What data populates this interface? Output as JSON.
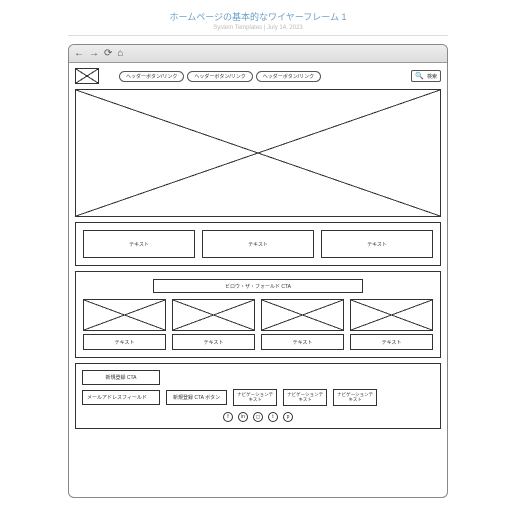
{
  "title": "ホームページの基本的なワイヤーフレーム 1",
  "subtitle": "System Templates  |  July 14, 2023",
  "nav": {
    "link1": "ヘッダーボタン/リンク",
    "link2": "ヘッダーボタン/リンク",
    "link3": "ヘッダーボタン/リンク",
    "search_label": "検索"
  },
  "row3": {
    "t1": "テキスト",
    "t2": "テキスト",
    "t3": "テキスト"
  },
  "cta": "ビロウ・ザ・フォールド CTA",
  "grid": {
    "cap": "テキスト"
  },
  "bottom": {
    "signup_cta": "新規登録 CTA",
    "email_placeholder": "メールアドレスフィールド",
    "signup_btn": "新規登録 CTA ボタン",
    "navtext": "ナビゲーションテキスト"
  },
  "social": {
    "fb": "f",
    "in": "in",
    "ig": "◻",
    "tw": "t",
    "pi": "p"
  }
}
